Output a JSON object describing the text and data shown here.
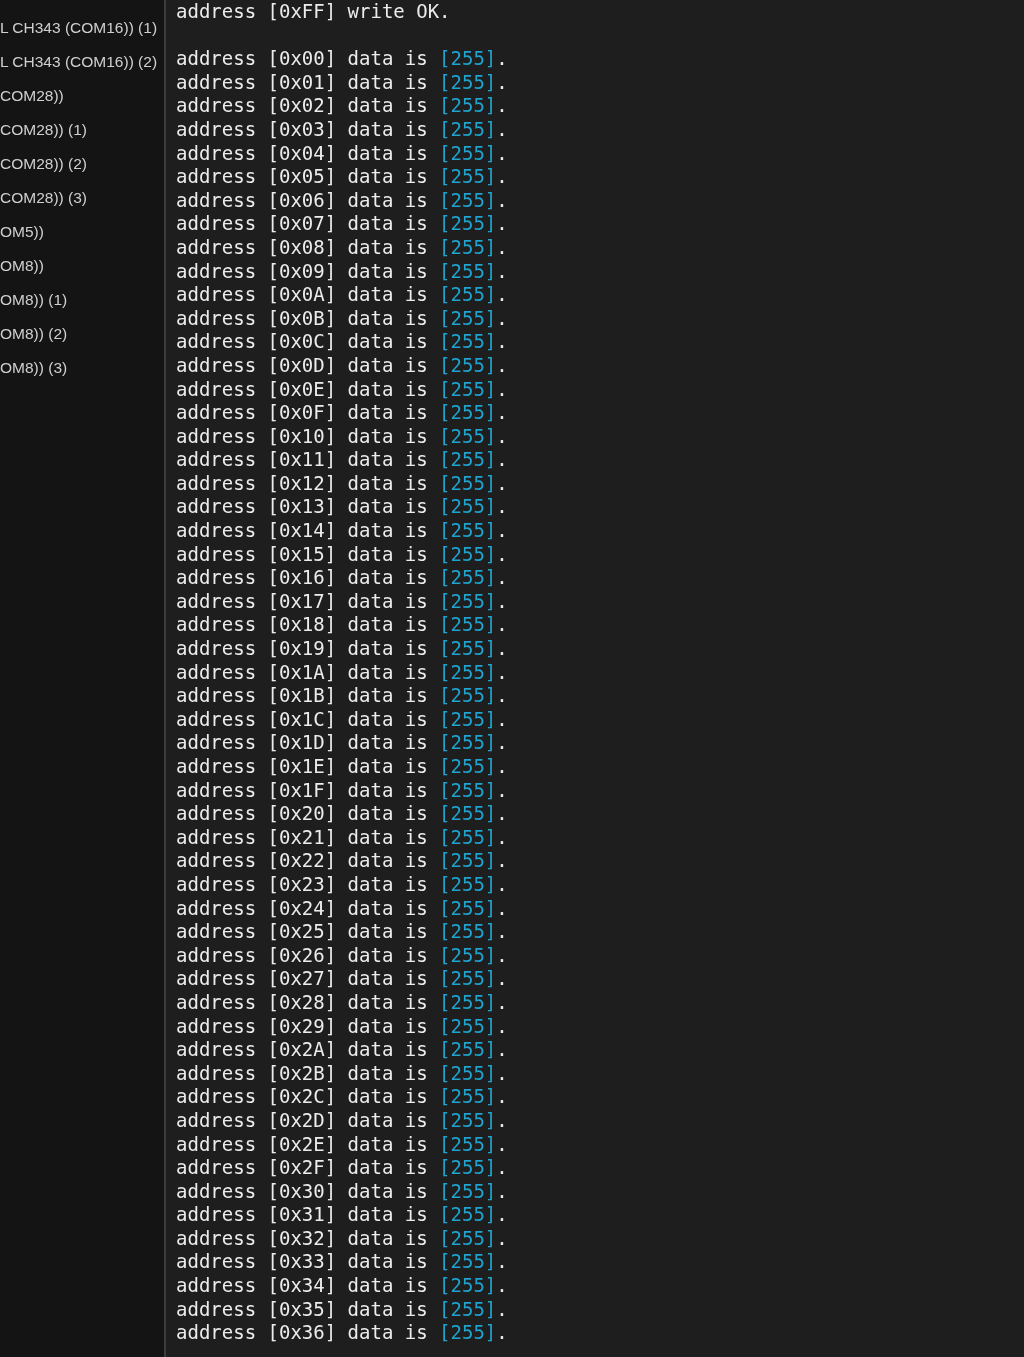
{
  "sidebar": {
    "items": [
      {
        "label": "L CH343 (COM16)) (1)"
      },
      {
        "label": "L CH343 (COM16)) (2)"
      },
      {
        "label": "COM28))"
      },
      {
        "label": "COM28)) (1)"
      },
      {
        "label": "COM28)) (2)"
      },
      {
        "label": "COM28)) (3)"
      },
      {
        "label": "OM5))"
      },
      {
        "label": "OM8))"
      },
      {
        "label": "OM8)) (1)"
      },
      {
        "label": "OM8)) (2)"
      },
      {
        "label": "OM8)) (3)"
      }
    ]
  },
  "terminal": {
    "lines": [
      {
        "kind": "status",
        "text": "address [0xFF] write OK."
      },
      {
        "kind": "data",
        "prefix": "address [0x00] data is ",
        "value": "[255]",
        "suffix": "."
      },
      {
        "kind": "data",
        "prefix": "address [0x01] data is ",
        "value": "[255]",
        "suffix": "."
      },
      {
        "kind": "data",
        "prefix": "address [0x02] data is ",
        "value": "[255]",
        "suffix": "."
      },
      {
        "kind": "data",
        "prefix": "address [0x03] data is ",
        "value": "[255]",
        "suffix": "."
      },
      {
        "kind": "data",
        "prefix": "address [0x04] data is ",
        "value": "[255]",
        "suffix": "."
      },
      {
        "kind": "data",
        "prefix": "address [0x05] data is ",
        "value": "[255]",
        "suffix": "."
      },
      {
        "kind": "data",
        "prefix": "address [0x06] data is ",
        "value": "[255]",
        "suffix": "."
      },
      {
        "kind": "data",
        "prefix": "address [0x07] data is ",
        "value": "[255]",
        "suffix": "."
      },
      {
        "kind": "data",
        "prefix": "address [0x08] data is ",
        "value": "[255]",
        "suffix": "."
      },
      {
        "kind": "data",
        "prefix": "address [0x09] data is ",
        "value": "[255]",
        "suffix": "."
      },
      {
        "kind": "data",
        "prefix": "address [0x0A] data is ",
        "value": "[255]",
        "suffix": "."
      },
      {
        "kind": "data",
        "prefix": "address [0x0B] data is ",
        "value": "[255]",
        "suffix": "."
      },
      {
        "kind": "data",
        "prefix": "address [0x0C] data is ",
        "value": "[255]",
        "suffix": "."
      },
      {
        "kind": "data",
        "prefix": "address [0x0D] data is ",
        "value": "[255]",
        "suffix": "."
      },
      {
        "kind": "data",
        "prefix": "address [0x0E] data is ",
        "value": "[255]",
        "suffix": "."
      },
      {
        "kind": "data",
        "prefix": "address [0x0F] data is ",
        "value": "[255]",
        "suffix": "."
      },
      {
        "kind": "data",
        "prefix": "address [0x10] data is ",
        "value": "[255]",
        "suffix": "."
      },
      {
        "kind": "data",
        "prefix": "address [0x11] data is ",
        "value": "[255]",
        "suffix": "."
      },
      {
        "kind": "data",
        "prefix": "address [0x12] data is ",
        "value": "[255]",
        "suffix": "."
      },
      {
        "kind": "data",
        "prefix": "address [0x13] data is ",
        "value": "[255]",
        "suffix": "."
      },
      {
        "kind": "data",
        "prefix": "address [0x14] data is ",
        "value": "[255]",
        "suffix": "."
      },
      {
        "kind": "data",
        "prefix": "address [0x15] data is ",
        "value": "[255]",
        "suffix": "."
      },
      {
        "kind": "data",
        "prefix": "address [0x16] data is ",
        "value": "[255]",
        "suffix": "."
      },
      {
        "kind": "data",
        "prefix": "address [0x17] data is ",
        "value": "[255]",
        "suffix": "."
      },
      {
        "kind": "data",
        "prefix": "address [0x18] data is ",
        "value": "[255]",
        "suffix": "."
      },
      {
        "kind": "data",
        "prefix": "address [0x19] data is ",
        "value": "[255]",
        "suffix": "."
      },
      {
        "kind": "data",
        "prefix": "address [0x1A] data is ",
        "value": "[255]",
        "suffix": "."
      },
      {
        "kind": "data",
        "prefix": "address [0x1B] data is ",
        "value": "[255]",
        "suffix": "."
      },
      {
        "kind": "data",
        "prefix": "address [0x1C] data is ",
        "value": "[255]",
        "suffix": "."
      },
      {
        "kind": "data",
        "prefix": "address [0x1D] data is ",
        "value": "[255]",
        "suffix": "."
      },
      {
        "kind": "data",
        "prefix": "address [0x1E] data is ",
        "value": "[255]",
        "suffix": "."
      },
      {
        "kind": "data",
        "prefix": "address [0x1F] data is ",
        "value": "[255]",
        "suffix": "."
      },
      {
        "kind": "data",
        "prefix": "address [0x20] data is ",
        "value": "[255]",
        "suffix": "."
      },
      {
        "kind": "data",
        "prefix": "address [0x21] data is ",
        "value": "[255]",
        "suffix": "."
      },
      {
        "kind": "data",
        "prefix": "address [0x22] data is ",
        "value": "[255]",
        "suffix": "."
      },
      {
        "kind": "data",
        "prefix": "address [0x23] data is ",
        "value": "[255]",
        "suffix": "."
      },
      {
        "kind": "data",
        "prefix": "address [0x24] data is ",
        "value": "[255]",
        "suffix": "."
      },
      {
        "kind": "data",
        "prefix": "address [0x25] data is ",
        "value": "[255]",
        "suffix": "."
      },
      {
        "kind": "data",
        "prefix": "address [0x26] data is ",
        "value": "[255]",
        "suffix": "."
      },
      {
        "kind": "data",
        "prefix": "address [0x27] data is ",
        "value": "[255]",
        "suffix": "."
      },
      {
        "kind": "data",
        "prefix": "address [0x28] data is ",
        "value": "[255]",
        "suffix": "."
      },
      {
        "kind": "data",
        "prefix": "address [0x29] data is ",
        "value": "[255]",
        "suffix": "."
      },
      {
        "kind": "data",
        "prefix": "address [0x2A] data is ",
        "value": "[255]",
        "suffix": "."
      },
      {
        "kind": "data",
        "prefix": "address [0x2B] data is ",
        "value": "[255]",
        "suffix": "."
      },
      {
        "kind": "data",
        "prefix": "address [0x2C] data is ",
        "value": "[255]",
        "suffix": "."
      },
      {
        "kind": "data",
        "prefix": "address [0x2D] data is ",
        "value": "[255]",
        "suffix": "."
      },
      {
        "kind": "data",
        "prefix": "address [0x2E] data is ",
        "value": "[255]",
        "suffix": "."
      },
      {
        "kind": "data",
        "prefix": "address [0x2F] data is ",
        "value": "[255]",
        "suffix": "."
      },
      {
        "kind": "data",
        "prefix": "address [0x30] data is ",
        "value": "[255]",
        "suffix": "."
      },
      {
        "kind": "data",
        "prefix": "address [0x31] data is ",
        "value": "[255]",
        "suffix": "."
      },
      {
        "kind": "data",
        "prefix": "address [0x32] data is ",
        "value": "[255]",
        "suffix": "."
      },
      {
        "kind": "data",
        "prefix": "address [0x33] data is ",
        "value": "[255]",
        "suffix": "."
      },
      {
        "kind": "data",
        "prefix": "address [0x34] data is ",
        "value": "[255]",
        "suffix": "."
      },
      {
        "kind": "data",
        "prefix": "address [0x35] data is ",
        "value": "[255]",
        "suffix": "."
      },
      {
        "kind": "data",
        "prefix": "address [0x36] data is ",
        "value": "[255]",
        "suffix": "."
      }
    ]
  }
}
